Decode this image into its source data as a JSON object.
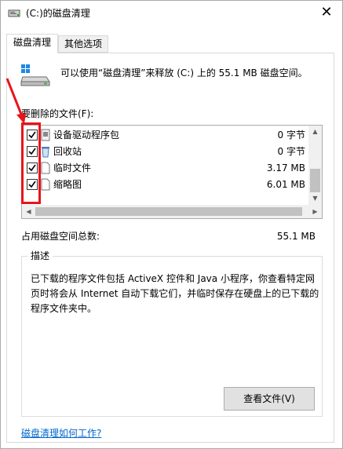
{
  "window": {
    "title": "(C:)的磁盘清理",
    "close_glyph": "✕"
  },
  "tabs": [
    {
      "label": "磁盘清理",
      "active": true
    },
    {
      "label": "其他选项",
      "active": false
    }
  ],
  "info": {
    "text": "可以使用“磁盘清理”来释放 (C:) 上的 55.1 MB 磁盘空间。"
  },
  "files": {
    "label": "要删除的文件(F):",
    "items": [
      {
        "name": "设备驱动程序包",
        "size": "0 字节",
        "checked": true,
        "icon": "driver-package-icon"
      },
      {
        "name": "回收站",
        "size": "0 字节",
        "checked": true,
        "icon": "recycle-bin-icon"
      },
      {
        "name": "临时文件",
        "size": "3.17 MB",
        "checked": true,
        "icon": "file-icon"
      },
      {
        "name": "缩略图",
        "size": "6.01 MB",
        "checked": true,
        "icon": "file-icon"
      }
    ]
  },
  "total": {
    "label": "占用磁盘空间总数:",
    "value": "55.1 MB"
  },
  "description": {
    "legend": "描述",
    "text": "已下载的程序文件包括 ActiveX 控件和 Java 小程序，你查看特定网页时将会从 Internet 自动下载它们，并临时保存在硬盘上的已下载的程序文件夹中。"
  },
  "buttons": {
    "view_files": "查看文件(V)"
  },
  "help_link": "磁盘清理如何工作?",
  "colors": {
    "highlight_box": "#e8141a",
    "link": "#0066cc"
  }
}
